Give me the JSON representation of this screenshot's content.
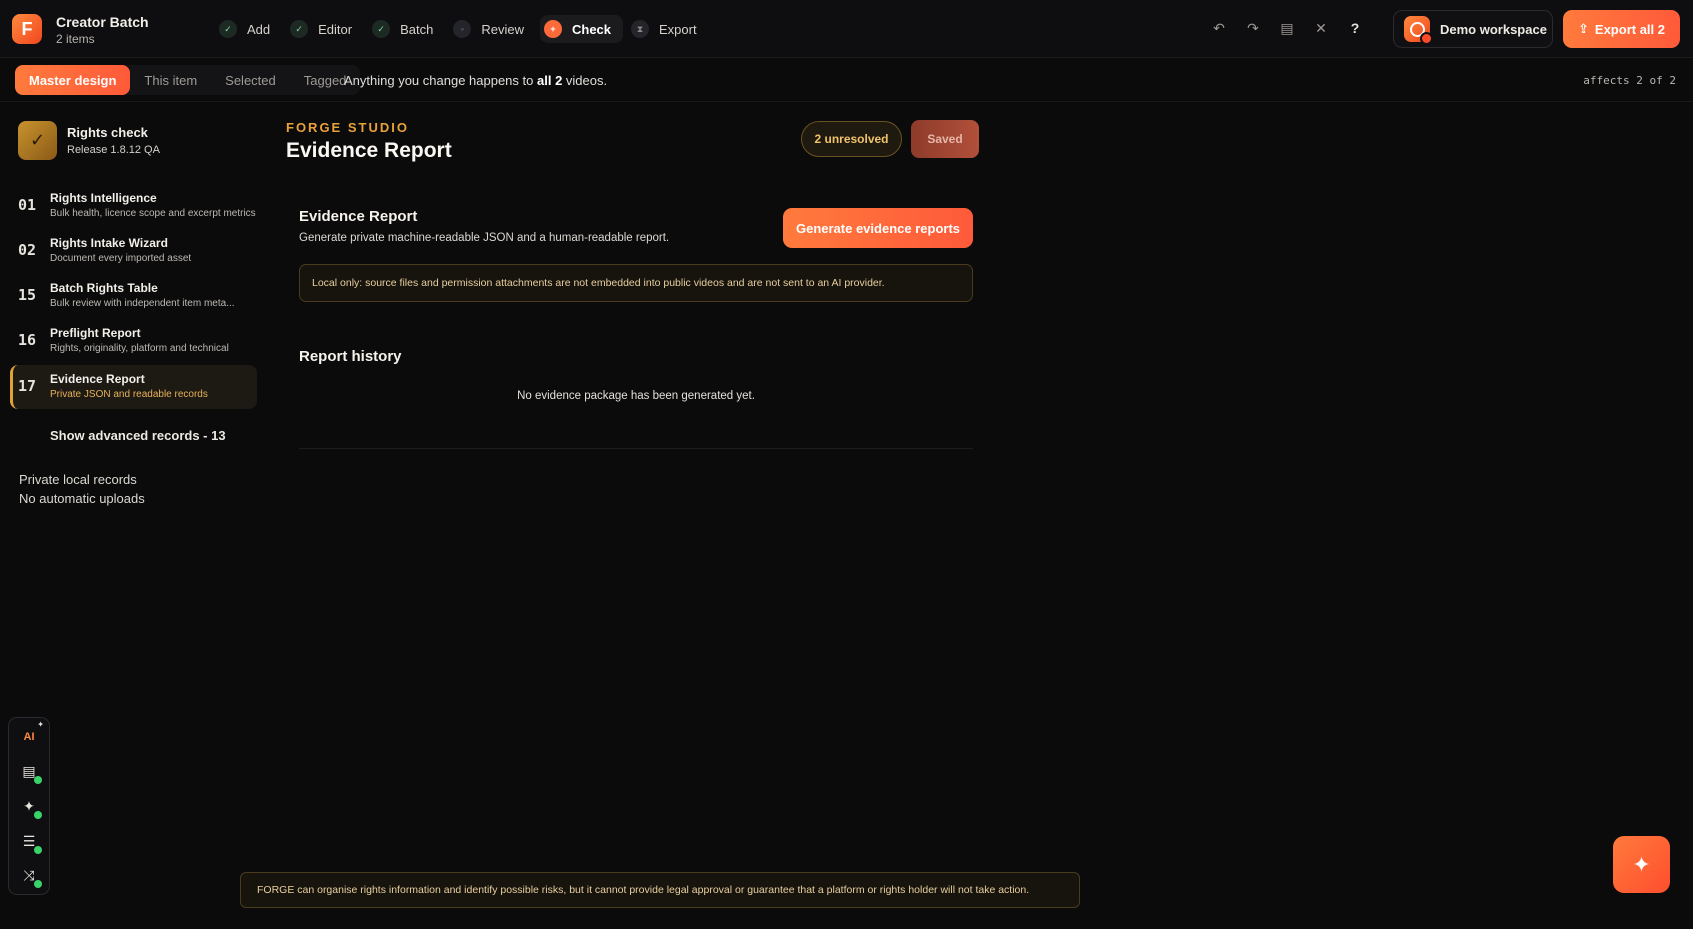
{
  "header": {
    "app_logo": "F",
    "title": "Creator Batch",
    "subtitle": "2 items",
    "steps": [
      {
        "label": "Add",
        "state": "done"
      },
      {
        "label": "Editor",
        "state": "done"
      },
      {
        "label": "Batch",
        "state": "done"
      },
      {
        "label": "Review",
        "state": "pending"
      },
      {
        "label": "Check",
        "state": "active"
      },
      {
        "label": "Export",
        "state": "pending"
      }
    ],
    "tools": [
      "undo-icon",
      "redo-icon",
      "layout-icon",
      "close-icon",
      "help-icon"
    ],
    "help_label": "?",
    "workspace_label": "Demo workspace",
    "export_label": "Export all 2"
  },
  "scope": {
    "tabs": [
      "Master design",
      "This item",
      "Selected",
      "Tagged"
    ],
    "active_tab": "Master design",
    "message_prefix": "Anything you change happens to",
    "message_bold": "all 2",
    "message_suffix": "videos.",
    "affects": "affects 2 of 2"
  },
  "sidebar": {
    "section_title": "Rights check",
    "section_sub": "Release 1.8.12 QA",
    "items": [
      {
        "num": "01",
        "label": "Rights Intelligence",
        "desc": "Bulk health, licence scope and excerpt metrics"
      },
      {
        "num": "02",
        "label": "Rights Intake Wizard",
        "desc": "Document every imported asset"
      },
      {
        "num": "15",
        "label": "Batch Rights Table",
        "desc": "Bulk review with independent item meta..."
      },
      {
        "num": "16",
        "label": "Preflight Report",
        "desc": "Rights, originality, platform and technical"
      },
      {
        "num": "17",
        "label": "Evidence Report",
        "desc": "Private JSON and readable records"
      }
    ],
    "active_index": 4,
    "show_advanced": "Show advanced records - 13",
    "private_line1": "Private local records",
    "private_line2": "No automatic uploads"
  },
  "dock": {
    "ai_label": "AI",
    "icons": [
      "chat-icon",
      "sparkle-icon",
      "sliders-icon",
      "shuffle-icon"
    ]
  },
  "main": {
    "kicker": "FORGE STUDIO",
    "title": "Evidence Report",
    "unresolved": "2 unresolved",
    "saved": "Saved",
    "report_title": "Evidence Report",
    "report_desc": "Generate private machine-readable JSON and a human-readable report.",
    "generate_label": "Generate evidence reports",
    "local_note": "Local only: source files and permission attachments are not embedded into public videos and are not sent to an AI provider.",
    "history_title": "Report history",
    "history_empty": "No evidence package has been generated yet."
  },
  "disclaimer": "FORGE can organise rights information and identify possible risks, but it cannot provide legal approval or guarantee that a platform or rights holder will not take action.",
  "colors": {
    "accent": "#ff6a3a",
    "gold": "#e9a13b",
    "background": "#0b0b0c"
  }
}
